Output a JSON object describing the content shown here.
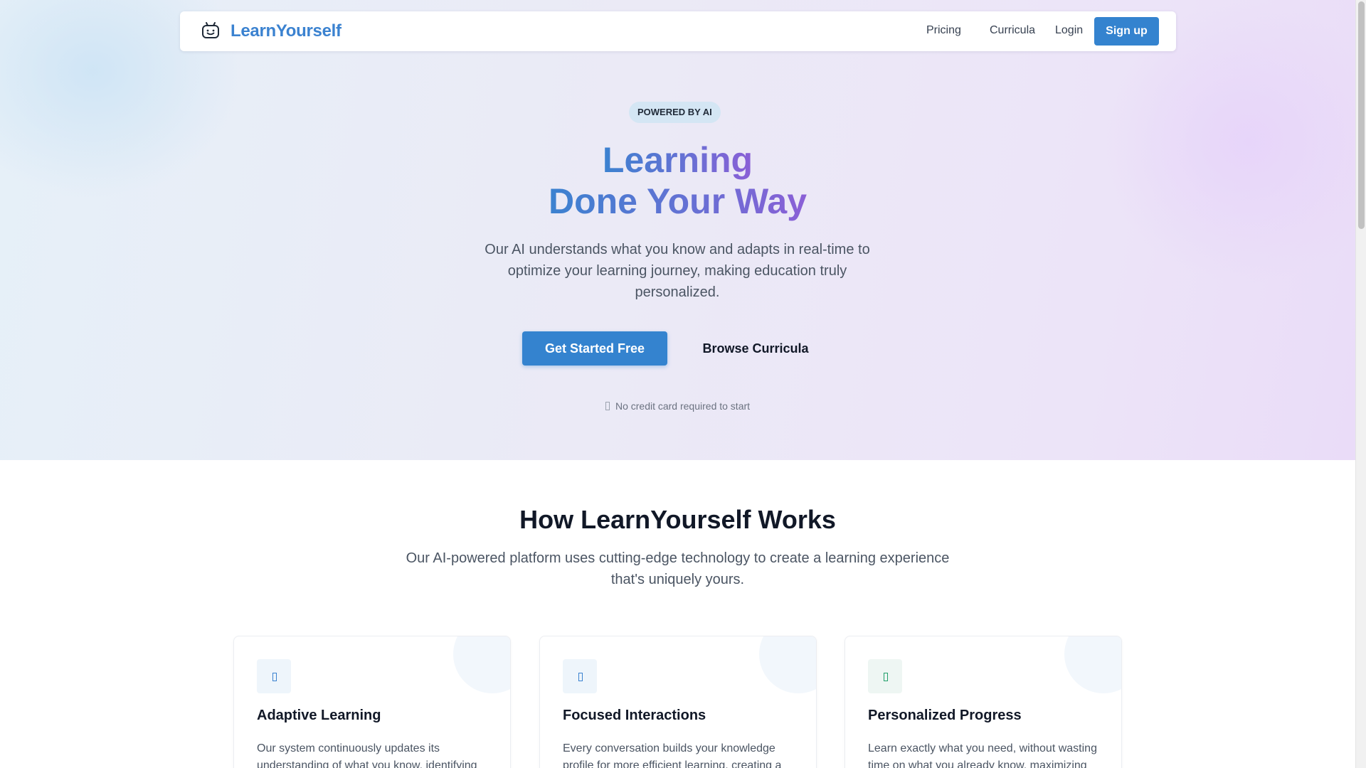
{
  "nav": {
    "brand": "LearnYourself",
    "links": [
      "Pricing",
      "Curricula",
      "Login"
    ],
    "signup": "Sign up"
  },
  "hero": {
    "badge": "POWERED BY AI",
    "title_line1": "Learning",
    "title_line2": "Done Your Way",
    "subtitle": "Our AI understands what you know and adapts in real-time to optimize your learning journey, making education truly personalized.",
    "cta_primary": "Get Started Free",
    "cta_secondary": "Browse Curricula",
    "note": "No credit card required to start",
    "note_icon": "missing-glyph-icon"
  },
  "how": {
    "title": "How LearnYourself Works",
    "subtitle": "Our AI-powered platform uses cutting-edge technology to create a learning experience that's uniquely yours."
  },
  "cards": [
    {
      "title": "Adaptive Learning",
      "text": "Our system continuously updates its understanding of what you know, identifying",
      "icon": "missing-glyph-icon",
      "icon_color": "#3b82d0"
    },
    {
      "title": "Focused Interactions",
      "text": "Every conversation builds your knowledge profile for more efficient learning, creating a",
      "icon": "missing-glyph-icon",
      "icon_color": "#3b82d0"
    },
    {
      "title": "Personalized Progress",
      "text": "Learn exactly what you need, without wasting time on what you already know, maximizing",
      "icon": "missing-glyph-icon",
      "icon_color": "#22a06b"
    }
  ],
  "colors": {
    "accent": "#3483cf",
    "brand_text": "#3b82d0",
    "gradient_end": "#8a5fd6"
  }
}
